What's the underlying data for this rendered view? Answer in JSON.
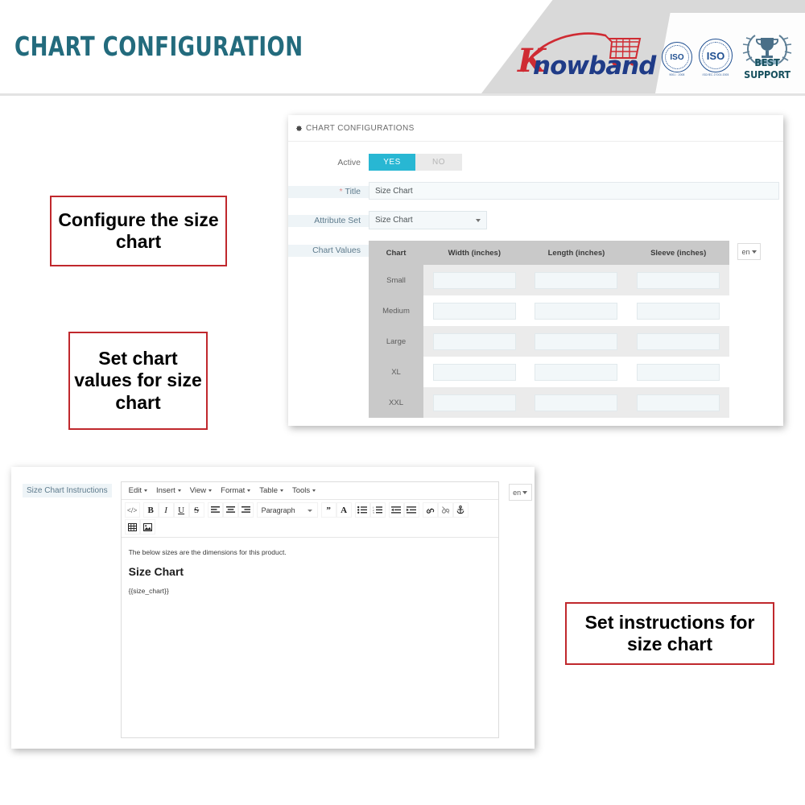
{
  "header": {
    "title": "CHART CONFIGURATION",
    "logo_k": "K",
    "logo_text": "nowband",
    "badges": {
      "iso1_label": "ISO",
      "iso1_sub": "9001 : 2008",
      "iso2_label": "ISO",
      "iso2_sub": "ISO/IEC 27001:2005",
      "support_label": "BEST SUPPORT"
    }
  },
  "top_panel": {
    "head_title": "CHART CONFIGURATIONS",
    "gear_icon": "gear-icon",
    "rows": {
      "active": {
        "label": "Active",
        "yes": "YES",
        "no": "NO",
        "selected": "YES"
      },
      "title": {
        "label": "Title",
        "required_mark": "*",
        "value": "Size Chart",
        "placeholder": "Size Chart"
      },
      "attribute_set": {
        "label": "Attribute Set",
        "value": "Size Chart",
        "options": [
          "Size Chart"
        ]
      },
      "chart_values": {
        "label": "Chart Values",
        "language": "en",
        "columns": [
          "Chart",
          "Width (inches)",
          "Length (inches)",
          "Sleeve (inches)"
        ],
        "rows": [
          {
            "size": "Small",
            "width": "",
            "length": "",
            "sleeve": ""
          },
          {
            "size": "Medium",
            "width": "",
            "length": "",
            "sleeve": ""
          },
          {
            "size": "Large",
            "width": "",
            "length": "",
            "sleeve": ""
          },
          {
            "size": "XL",
            "width": "",
            "length": "",
            "sleeve": ""
          },
          {
            "size": "XXL",
            "width": "",
            "length": "",
            "sleeve": ""
          }
        ]
      }
    }
  },
  "bottom_panel": {
    "label": "Size Chart Instructions",
    "language": "en",
    "menubar": [
      "Edit",
      "Insert",
      "View",
      "Format",
      "Table",
      "Tools"
    ],
    "toolbar": {
      "paragraph_label": "Paragraph",
      "buttons": [
        "source-code-icon",
        "bold-icon",
        "italic-icon",
        "underline-icon",
        "strikethrough-icon",
        "align-left-icon",
        "align-center-icon",
        "align-right-icon",
        "blockquote-icon",
        "text-color-icon",
        "bullet-list-icon",
        "numbered-list-icon",
        "outdent-icon",
        "indent-icon",
        "link-icon",
        "unlink-icon",
        "anchor-icon",
        "table-icon",
        "image-icon"
      ]
    },
    "content": {
      "paragraph": "The below sizes are the dimensions for this product.",
      "heading": "Size Chart",
      "code": "{{size_chart}}"
    }
  },
  "callouts": [
    {
      "text": "Configure the size chart"
    },
    {
      "text": "Set chart values for size chart"
    },
    {
      "text": "Set instructions for size chart"
    }
  ],
  "colors": {
    "title_teal": "#236b7d",
    "accent_cyan": "#28b7d3",
    "callout_red": "#c0282d",
    "label_blue": "#5d7a8c",
    "logo_blue": "#1f3b87",
    "logo_red": "#cf2b33"
  }
}
